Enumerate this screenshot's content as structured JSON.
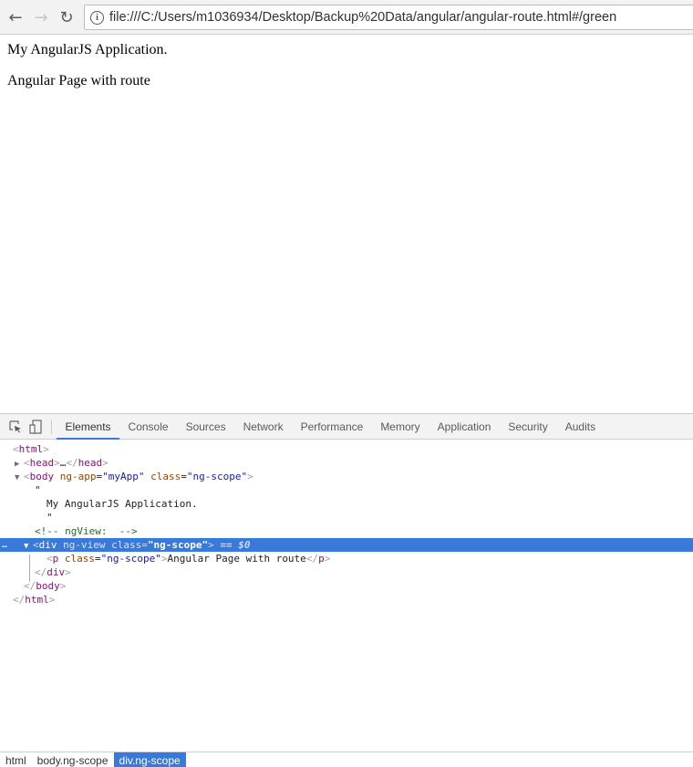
{
  "browser": {
    "back_icon": "arrow-left-icon",
    "forward_icon": "arrow-right-icon",
    "reload_icon": "reload-icon",
    "info_icon": "info-icon",
    "url": "file:///C:/Users/m1036934/Desktop/Backup%20Data/angular/angular-route.html#/green"
  },
  "page": {
    "heading_text": "My AngularJS Application.",
    "route_text": "Angular Page with route"
  },
  "devtools": {
    "tabs": [
      {
        "label": "Elements",
        "active": true
      },
      {
        "label": "Console"
      },
      {
        "label": "Sources"
      },
      {
        "label": "Network"
      },
      {
        "label": "Performance"
      },
      {
        "label": "Memory"
      },
      {
        "label": "Application"
      },
      {
        "label": "Security"
      },
      {
        "label": "Audits"
      }
    ],
    "tree": {
      "html_open": "html",
      "head_tag": "head",
      "head_ellipsis": "…",
      "body_tag": "body",
      "body_attr1_name": "ng-app",
      "body_attr1_value": "\"myApp\"",
      "body_attr2_name": "class",
      "body_attr2_value": "\"ng-scope\"",
      "quote": "\"",
      "text_node": "My AngularJS Application.",
      "comment": "<!-- ngView:  -->",
      "div_tag": "div",
      "div_attr1": "ng-view",
      "div_attr2_name": "class",
      "div_attr2_value": "\"ng-scope\"",
      "selected_marker": "== $0",
      "p_tag": "p",
      "p_attr_name": "class",
      "p_attr_value": "\"ng-scope\"",
      "p_text": "Angular Page with route"
    },
    "breadcrumbs": [
      {
        "label": "html"
      },
      {
        "label": "body.ng-scope"
      },
      {
        "label": "div.ng-scope",
        "active": true
      }
    ]
  },
  "colors": {
    "selection": "#3879d9",
    "tag": "#881280",
    "attr": "#994500",
    "value": "#1a1aa6",
    "comment": "#236e25"
  }
}
